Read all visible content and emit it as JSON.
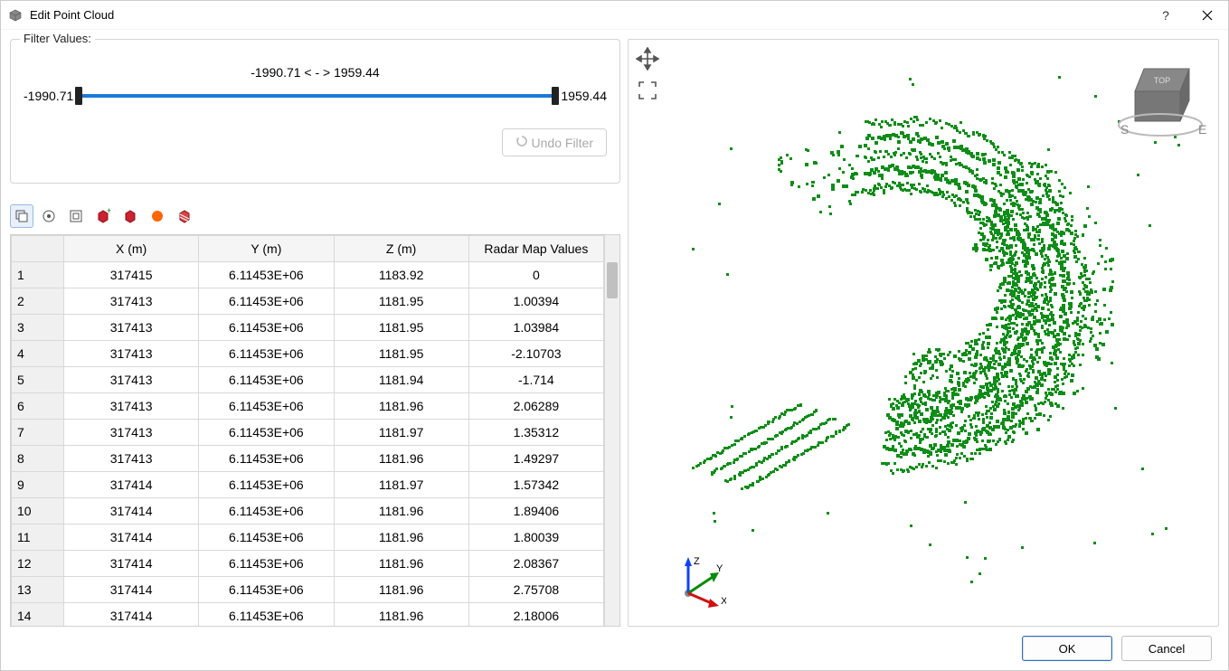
{
  "window": {
    "title": "Edit Point Cloud"
  },
  "filter": {
    "legend": "Filter Values:",
    "rangeLabel": "-1990.71 < - > 1959.44",
    "minLabel": "-1990.71",
    "maxLabel": "1959.44",
    "undoLabel": "Undo Filter"
  },
  "toolbar": {
    "items": [
      {
        "name": "copy-icon",
        "pressed": true
      },
      {
        "name": "target-icon",
        "pressed": false
      },
      {
        "name": "box-icon",
        "pressed": false
      },
      {
        "name": "cube-add-icon",
        "pressed": false
      },
      {
        "name": "cube-red-icon",
        "pressed": false
      },
      {
        "name": "sphere-orange-icon",
        "pressed": false
      },
      {
        "name": "cube-hatch-icon",
        "pressed": false
      }
    ]
  },
  "table": {
    "headers": [
      "X (m)",
      "Y (m)",
      "Z (m)",
      "Radar Map Values"
    ],
    "rows": [
      {
        "n": "1",
        "x": "317415",
        "y": "6.11453E+06",
        "z": "1183.92",
        "v": "0"
      },
      {
        "n": "2",
        "x": "317413",
        "y": "6.11453E+06",
        "z": "1181.95",
        "v": "1.00394"
      },
      {
        "n": "3",
        "x": "317413",
        "y": "6.11453E+06",
        "z": "1181.95",
        "v": "1.03984"
      },
      {
        "n": "4",
        "x": "317413",
        "y": "6.11453E+06",
        "z": "1181.95",
        "v": "-2.10703"
      },
      {
        "n": "5",
        "x": "317413",
        "y": "6.11453E+06",
        "z": "1181.94",
        "v": "-1.714"
      },
      {
        "n": "6",
        "x": "317413",
        "y": "6.11453E+06",
        "z": "1181.96",
        "v": "2.06289"
      },
      {
        "n": "7",
        "x": "317413",
        "y": "6.11453E+06",
        "z": "1181.97",
        "v": "1.35312"
      },
      {
        "n": "8",
        "x": "317413",
        "y": "6.11453E+06",
        "z": "1181.96",
        "v": "1.49297"
      },
      {
        "n": "9",
        "x": "317414",
        "y": "6.11453E+06",
        "z": "1181.97",
        "v": "1.57342"
      },
      {
        "n": "10",
        "x": "317414",
        "y": "6.11453E+06",
        "z": "1181.96",
        "v": "1.89406"
      },
      {
        "n": "11",
        "x": "317414",
        "y": "6.11453E+06",
        "z": "1181.96",
        "v": "1.80039"
      },
      {
        "n": "12",
        "x": "317414",
        "y": "6.11453E+06",
        "z": "1181.96",
        "v": "2.08367"
      },
      {
        "n": "13",
        "x": "317414",
        "y": "6.11453E+06",
        "z": "1181.96",
        "v": "2.75708"
      },
      {
        "n": "14",
        "x": "317414",
        "y": "6.11453E+06",
        "z": "1181.96",
        "v": "2.18006"
      }
    ]
  },
  "viewer": {
    "compass": {
      "south": "S",
      "east": "E",
      "top": "TOP"
    },
    "axes": {
      "x": "X",
      "y": "Y",
      "z": "Z"
    }
  },
  "footer": {
    "ok": "OK",
    "cancel": "Cancel"
  }
}
